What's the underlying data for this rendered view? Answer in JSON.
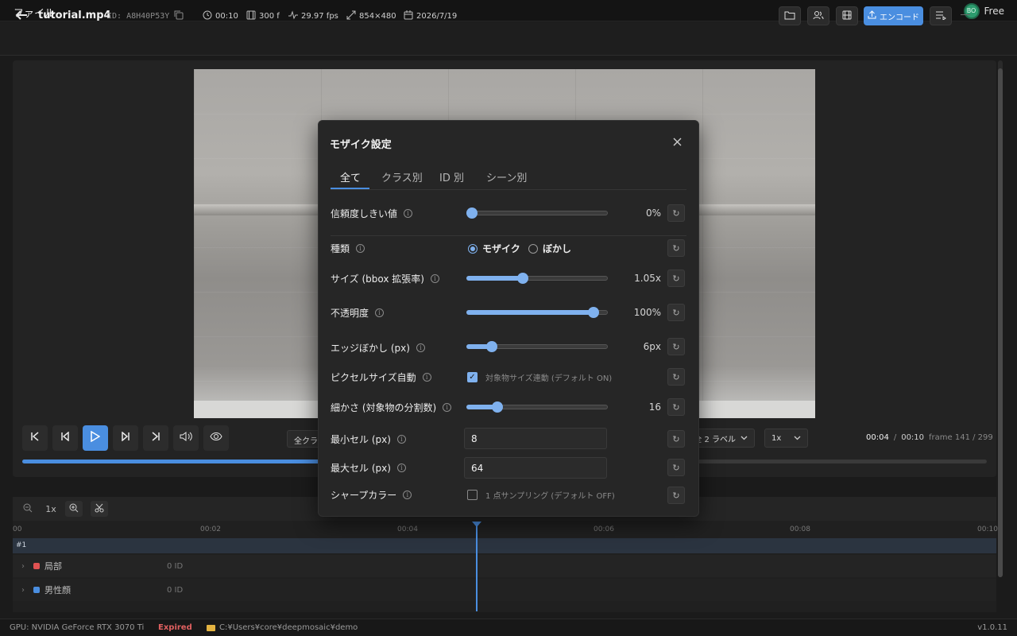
{
  "menubar": {
    "file_label": "ファイル",
    "avatar_initials": "BO",
    "plan": "Free"
  },
  "header": {
    "filename": "tutorial.mp4",
    "id_text": "ID: A8H40P53Y",
    "duration": "00:10",
    "frames": "300 f",
    "fps": "29.97 fps",
    "resolution": "854×480",
    "date": "2026/7/19",
    "encode_label": "エンコード"
  },
  "player": {
    "class_select": "全クラス",
    "label_select": "全 2 ラベル",
    "speed": "1x",
    "current_time": "00:04",
    "separator": "/",
    "total_time": "00:10",
    "frame_text": "frame 141 / 299",
    "progress": 0.47
  },
  "timeline": {
    "zoom": "1x",
    "ticks": [
      "00",
      "00:02",
      "00:04",
      "00:06",
      "00:08",
      "00:10"
    ],
    "track_header": "#1",
    "tracks": [
      {
        "name": "局部",
        "count": "0 ID",
        "color": "#e05252"
      },
      {
        "name": "男性顔",
        "count": "0 ID",
        "color": "#4a8ee0"
      }
    ],
    "playhead_fraction": 0.4
  },
  "status": {
    "gpu": "GPU: NVIDIA GeForce RTX 3070 Ti",
    "license": "Expired",
    "path": "C:¥Users¥core¥deepmosaic¥demo",
    "version": "v1.0.11"
  },
  "modal": {
    "title": "モザイク設定",
    "tabs": [
      "全て",
      "クラス別",
      "ID 別",
      "シーン別"
    ],
    "active_tab": 0,
    "fields": {
      "confidence": {
        "label": "信頼度しきい値",
        "value": "0%",
        "level": 0.0
      },
      "type": {
        "label": "種類",
        "options": [
          "モザイク",
          "ぼかし"
        ],
        "selected": 0
      },
      "size": {
        "label": "サイズ (bbox 拡張率)",
        "value": "1.05x",
        "level": 0.4
      },
      "opacity": {
        "label": "不透明度",
        "value": "100%",
        "level": 0.9
      },
      "edge_blur": {
        "label": "エッジぼかし (px)",
        "value": "6px",
        "level": 0.18
      },
      "pixel_auto": {
        "label": "ピクセルサイズ自動",
        "checkbox_text": "対象物サイズ連動 (デフォルト ON)",
        "checked": true
      },
      "detail": {
        "label": "細かさ (対象物の分割数)",
        "value": "16",
        "level": 0.22
      },
      "min_cell": {
        "label": "最小セル (px)",
        "value": "8"
      },
      "max_cell": {
        "label": "最大セル (px)",
        "value": "64"
      },
      "sharp_color": {
        "label": "シャープカラー",
        "checkbox_text": "1 点サンプリング (デフォルト OFF)",
        "checked": false
      }
    }
  }
}
